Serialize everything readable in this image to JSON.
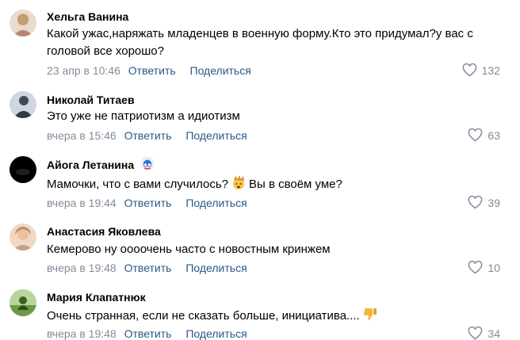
{
  "comments": [
    {
      "author": "Хельга Ванина",
      "text": "Какой ужас,наряжать младенцев в военную форму.Кто это придумал?у вас с головой все хорошо?",
      "time": "23 апр в 10:46",
      "reply_label": "Ответить",
      "share_label": "Поделиться",
      "likes": "132",
      "avatar_colors": [
        "#e9dccf",
        "#c69b6d"
      ]
    },
    {
      "author": "Николай Титаев",
      "text": "Это уже не патриотизм а идиотизм",
      "time": "вчера в 15:46",
      "reply_label": "Ответить",
      "share_label": "Поделиться",
      "likes": "63",
      "avatar_colors": [
        "#cfd6df",
        "#3b4a5c"
      ]
    },
    {
      "author": "Айога Летанина",
      "text_before": "Мамочки, что с вами случилось?",
      "text_after": "Вы в своём уме?",
      "time": "вчера в 19:44",
      "reply_label": "Ответить",
      "share_label": "Поделиться",
      "likes": "39",
      "avatar_colors": [
        "#000000",
        "#222222"
      ]
    },
    {
      "author": "Анастасия Яковлева",
      "text": "Кемерово ну оооочень часто с новостным кринжем",
      "time": "вчера в 19:48",
      "reply_label": "Ответить",
      "share_label": "Поделиться",
      "likes": "10",
      "avatar_colors": [
        "#f0d9c4",
        "#b88a63"
      ]
    },
    {
      "author": "Мария Клапатнюк",
      "text": "Очень странная, если не сказать больше, инициатива....",
      "time": "вчера в 19:48",
      "reply_label": "Ответить",
      "share_label": "Поделиться",
      "likes": "34",
      "avatar_colors": [
        "#9bbf7a",
        "#4d7a35"
      ]
    }
  ],
  "colors": {
    "link": "#2a5885",
    "meta": "#818c99"
  }
}
